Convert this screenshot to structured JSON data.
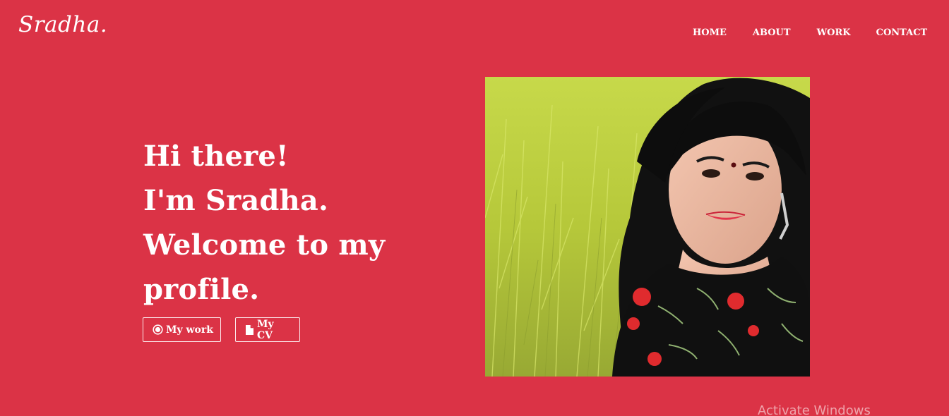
{
  "brand": {
    "logo_text": "Sradha."
  },
  "nav": {
    "items": [
      {
        "label": "HOME"
      },
      {
        "label": "ABOUT"
      },
      {
        "label": "WORK"
      },
      {
        "label": "CONTACT"
      }
    ]
  },
  "hero": {
    "lines": [
      "Hi there!",
      "I'm Sradha.",
      "Welcome to my",
      "profile."
    ],
    "buttons": {
      "work_label": "My work",
      "work_icon": "target-icon",
      "cv_label": "My CV",
      "cv_icon": "document-icon"
    }
  },
  "os_overlay": {
    "watermark": "Activate Windows"
  },
  "colors": {
    "background": "#db3346",
    "text": "#ffffff"
  }
}
